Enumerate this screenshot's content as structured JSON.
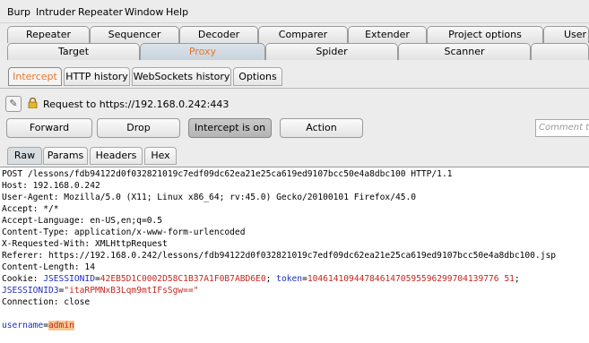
{
  "menu": [
    "Burp",
    "Intruder",
    "Repeater",
    "Window",
    "Help"
  ],
  "tabs_row1": [
    "Repeater",
    "Sequencer",
    "Decoder",
    "Comparer",
    "Extender",
    "Project options",
    "User"
  ],
  "tabs_row2": [
    "Target",
    "Proxy",
    "Spider",
    "Scanner"
  ],
  "proxy_tabs": [
    "Intercept",
    "HTTP history",
    "WebSockets history",
    "Options"
  ],
  "request_to": "Request to https://192.168.0.242:443",
  "buttons": {
    "forward": "Forward",
    "drop": "Drop",
    "intercept": "Intercept is on",
    "action": "Action"
  },
  "comment_placeholder": "Comment this item",
  "view_tabs": [
    "Raw",
    "Params",
    "Headers",
    "Hex"
  ],
  "raw": {
    "request_line": "POST /lessons/fdb94122d0f032821019c7edf09dc62ea21e25ca619ed9107bcc50e4a8dbc100 HTTP/1.1",
    "headers": [
      "Host: 192.168.0.242",
      "User-Agent: Mozilla/5.0 (X11; Linux x86_64; rv:45.0) Gecko/20100101 Firefox/45.0",
      "Accept: */*",
      "Accept-Language: en-US,en;q=0.5",
      "Content-Type: application/x-www-form-urlencoded",
      "X-Requested-With: XMLHttpRequest",
      "Referer: https://192.168.0.242/lessons/fdb94122d0f032821019c7edf09dc62ea21e25ca619ed9107bcc50e4a8dbc100.jsp",
      "Content-Length: 14"
    ],
    "cookie_prefix": "Cookie: ",
    "cookie1_name": "JSESSIONID",
    "cookie1_value": "42EB5D1C0002D58C1B37A1F0B7ABD6E0",
    "cookie2_name": "token",
    "cookie2_value": "1046141094478461470595596299704139776 51",
    "cookie3_name": "JSESSIONID3",
    "cookie3_value": "\"itaRPMNxB3Lqm9mtIFsSgw==\"",
    "connection": "Connection: close",
    "body_name": "username",
    "body_value": "admin"
  },
  "colors": {
    "accent_orange": "#e8762b",
    "param_blue": "#1f2fbf",
    "value_red": "#c4271f",
    "highlight": "#f7c98f"
  }
}
